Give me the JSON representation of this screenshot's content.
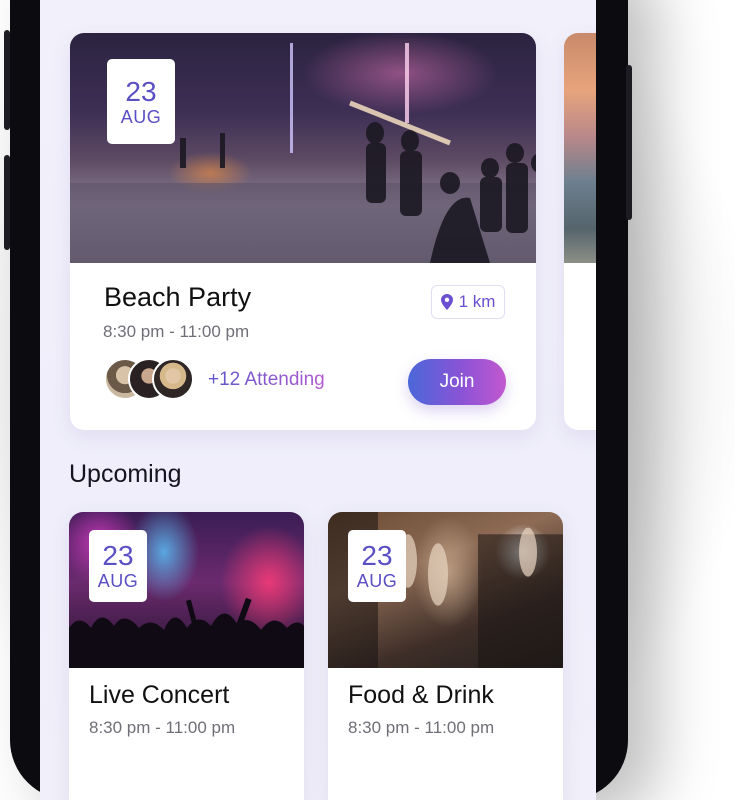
{
  "featured": {
    "date_day": "23",
    "date_month": "AUG",
    "title": "Beach Party",
    "time": "8:30 pm - 11:00 pm",
    "distance": "1 km",
    "attending": "+12 Attending",
    "join_label": "Join"
  },
  "upcoming": {
    "section_title": "Upcoming",
    "events": [
      {
        "date_day": "23",
        "date_month": "AUG",
        "title": "Live Concert",
        "time": "8:30 pm - 11:00 pm"
      },
      {
        "date_day": "23",
        "date_month": "AUG",
        "title": "Food & Drink",
        "time": "8:30 pm - 11:00 pm"
      }
    ]
  },
  "icons": {
    "distance": "map-pin-icon"
  },
  "colors": {
    "accent": "#5b4fc4",
    "gradient_start": "#4a68d8",
    "gradient_end": "#c258cf"
  }
}
